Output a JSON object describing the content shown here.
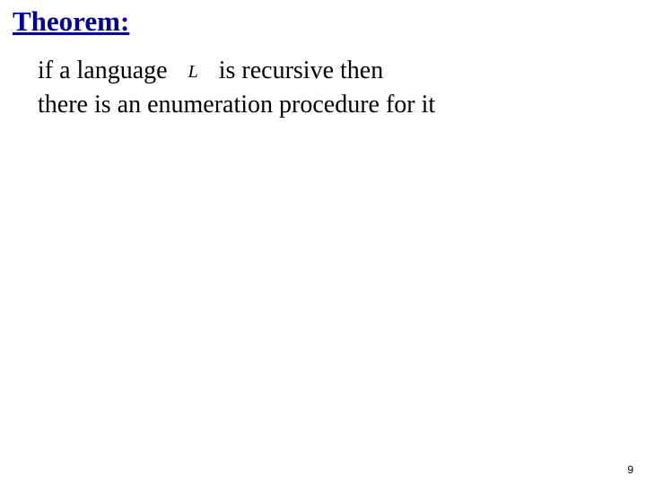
{
  "heading": "Theorem:",
  "body": {
    "pre": "if a language",
    "var": "L",
    "mid": "is recursive then",
    "line2": "there is an enumeration procedure for it"
  },
  "pagenum": "9"
}
